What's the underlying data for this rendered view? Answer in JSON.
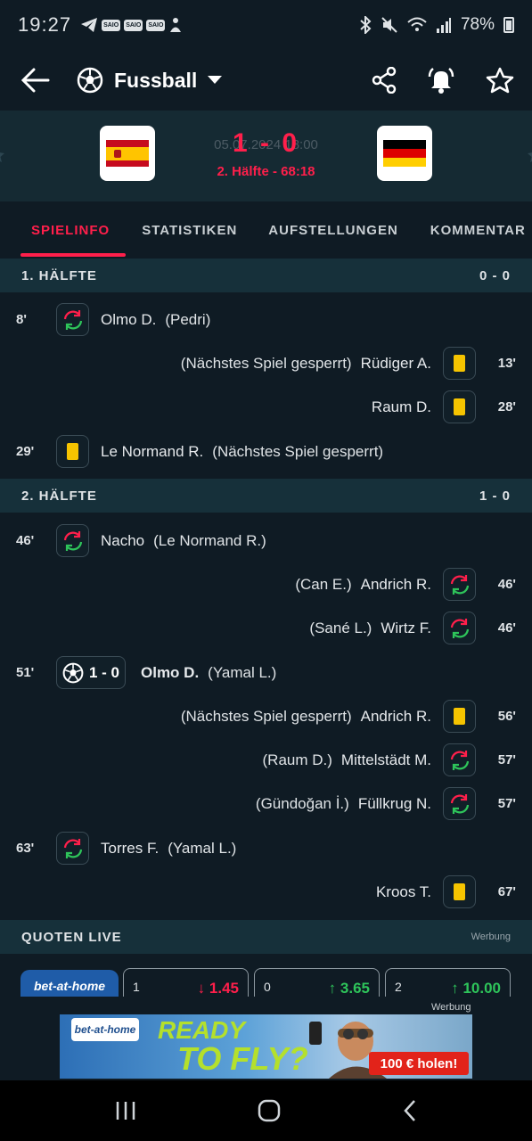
{
  "status_bar": {
    "time": "19:27",
    "pills": [
      "SAIO",
      "SAIO",
      "SAIO"
    ],
    "battery": "78%"
  },
  "appbar": {
    "title": "Fussball"
  },
  "match": {
    "date": "05.07.2024 18:00",
    "score": "1 - 0",
    "status": "2. Hälfte - 68:18"
  },
  "tabs": [
    "SPIELINFO",
    "STATISTIKEN",
    "AUFSTELLUNGEN",
    "KOMMENTAR"
  ],
  "sections": [
    {
      "title": "1. HÄLFTE",
      "score": "0 - 0",
      "events": [
        {
          "side": "home",
          "minute": "8'",
          "type": "sub",
          "player": "Olmo D.",
          "detail": "(Pedri)"
        },
        {
          "side": "away",
          "minute": "13'",
          "type": "yellow",
          "player": "Rüdiger A.",
          "detail": "(Nächstes Spiel gesperrt)"
        },
        {
          "side": "away",
          "minute": "28'",
          "type": "yellow",
          "player": "Raum D.",
          "detail": ""
        },
        {
          "side": "home",
          "minute": "29'",
          "type": "yellow",
          "player": "Le Normand R.",
          "detail": "(Nächstes Spiel gesperrt)"
        }
      ]
    },
    {
      "title": "2. HÄLFTE",
      "score": "1 - 0",
      "events": [
        {
          "side": "home",
          "minute": "46'",
          "type": "sub",
          "player": "Nacho",
          "detail": "(Le Normand R.)"
        },
        {
          "side": "away",
          "minute": "46'",
          "type": "sub",
          "player": "Andrich R.",
          "detail": "(Can E.)"
        },
        {
          "side": "away",
          "minute": "46'",
          "type": "sub",
          "player": "Wirtz F.",
          "detail": "(Sané L.)"
        },
        {
          "side": "home",
          "minute": "51'",
          "type": "goal",
          "goal_score": "1 - 0",
          "player": "Olmo D.",
          "detail": "(Yamal L.)"
        },
        {
          "side": "away",
          "minute": "56'",
          "type": "yellow",
          "player": "Andrich R.",
          "detail": "(Nächstes Spiel gesperrt)"
        },
        {
          "side": "away",
          "minute": "57'",
          "type": "sub",
          "player": "Mittelstädt M.",
          "detail": "(Raum D.)"
        },
        {
          "side": "away",
          "minute": "57'",
          "type": "sub",
          "player": "Füllkrug N.",
          "detail": "(Gündoğan İ.)"
        },
        {
          "side": "home",
          "minute": "63'",
          "type": "sub",
          "player": "Torres F.",
          "detail": "(Yamal L.)"
        },
        {
          "side": "away",
          "minute": "67'",
          "type": "yellow",
          "player": "Kroos T.",
          "detail": ""
        }
      ]
    }
  ],
  "odds": {
    "title": "QUOTEN LIVE",
    "ad_label": "Werbung",
    "bookmaker": "bet-at-home",
    "items": [
      {
        "key": "1",
        "value": "1.45",
        "trend": "down"
      },
      {
        "key": "0",
        "value": "3.65",
        "trend": "up"
      },
      {
        "key": "2",
        "value": "10.00",
        "trend": "up"
      }
    ],
    "ad_label_2": "Werbung"
  },
  "banner": {
    "logo": "bet-at-home",
    "line1": "READY",
    "line2": "TO FLY?",
    "cta": "100 € holen!"
  },
  "colors": {
    "accent": "#ff1f4b",
    "card": "#f6c400",
    "up": "#2ec45a",
    "bg": "#0f1b24"
  }
}
